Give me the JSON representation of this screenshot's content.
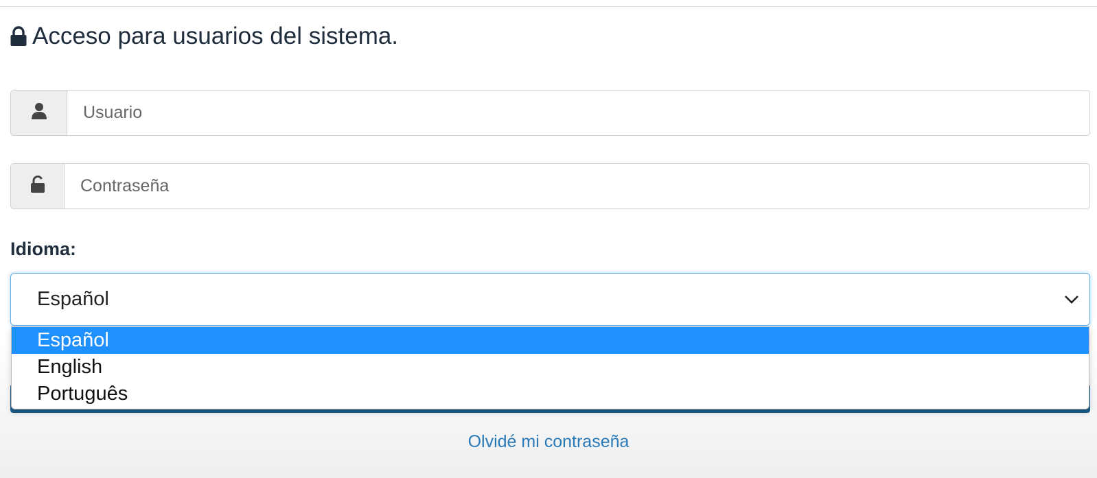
{
  "heading": {
    "icon": "lock-icon",
    "text": "Acceso para usuarios del sistema."
  },
  "username": {
    "icon": "user-icon",
    "placeholder": "Usuario",
    "value": ""
  },
  "password": {
    "icon": "unlock-icon",
    "placeholder": "Contraseña",
    "value": ""
  },
  "language": {
    "label": "Idioma:",
    "selected": "Español",
    "options": [
      "Español",
      "English",
      "Português"
    ],
    "highlighted_option": "Español"
  },
  "links": {
    "forgot_password": "Olvidé mi contraseña"
  },
  "colors": {
    "heading": "#1f2d3d",
    "focus_border": "#66afe9",
    "option_highlight": "#1e90ff",
    "link": "#2a7ab8",
    "submit_button": "#1d5e8e"
  }
}
